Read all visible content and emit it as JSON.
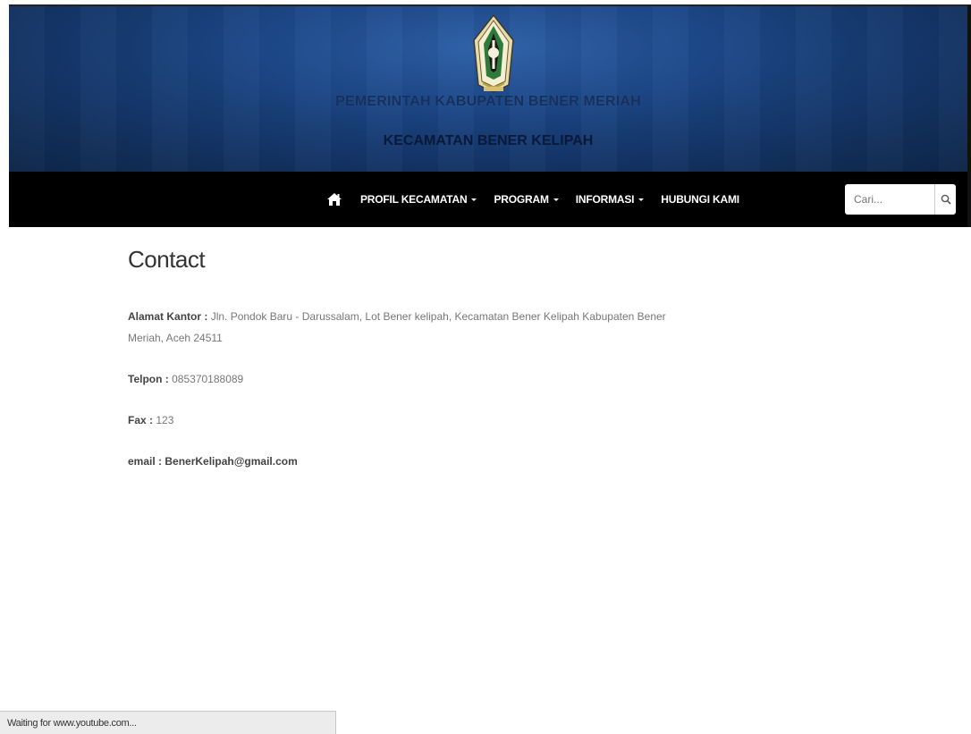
{
  "header": {
    "title_line1": "PEMERINTAH KABUPATEN BENER MERIAH",
    "title_line2": "KECAMATAN BENER KELIPAH"
  },
  "nav": {
    "home_icon": "home-icon",
    "items": [
      {
        "label": "PROFIL KECAMATAN",
        "has_dropdown": true
      },
      {
        "label": "PROGRAM",
        "has_dropdown": true
      },
      {
        "label": "INFORMASI",
        "has_dropdown": true
      },
      {
        "label": "HUBUNGI KAMI",
        "has_dropdown": false
      }
    ],
    "search": {
      "placeholder": "Cari...",
      "icon": "search-icon"
    }
  },
  "page": {
    "title": "Contact",
    "address_label": "Alamat Kantor :",
    "address_value": "Jln. Pondok Baru - Darussalam, Lot Bener kelipah, Kecamatan Bener Kelipah Kabupaten Bener Meriah, Aceh 24511",
    "phone_label": "Telpon :",
    "phone_value": "085370188089",
    "fax_label": "Fax :",
    "fax_value": "123",
    "email_label": "email :",
    "email_value": "BenerKelipah@gmail.com"
  },
  "status_bar": {
    "text": "Waiting for www.youtube.com..."
  },
  "colors": {
    "banner": "#1e4a8c",
    "navbar": "#000000",
    "title1": "#16305c",
    "title2": "#081a38"
  }
}
